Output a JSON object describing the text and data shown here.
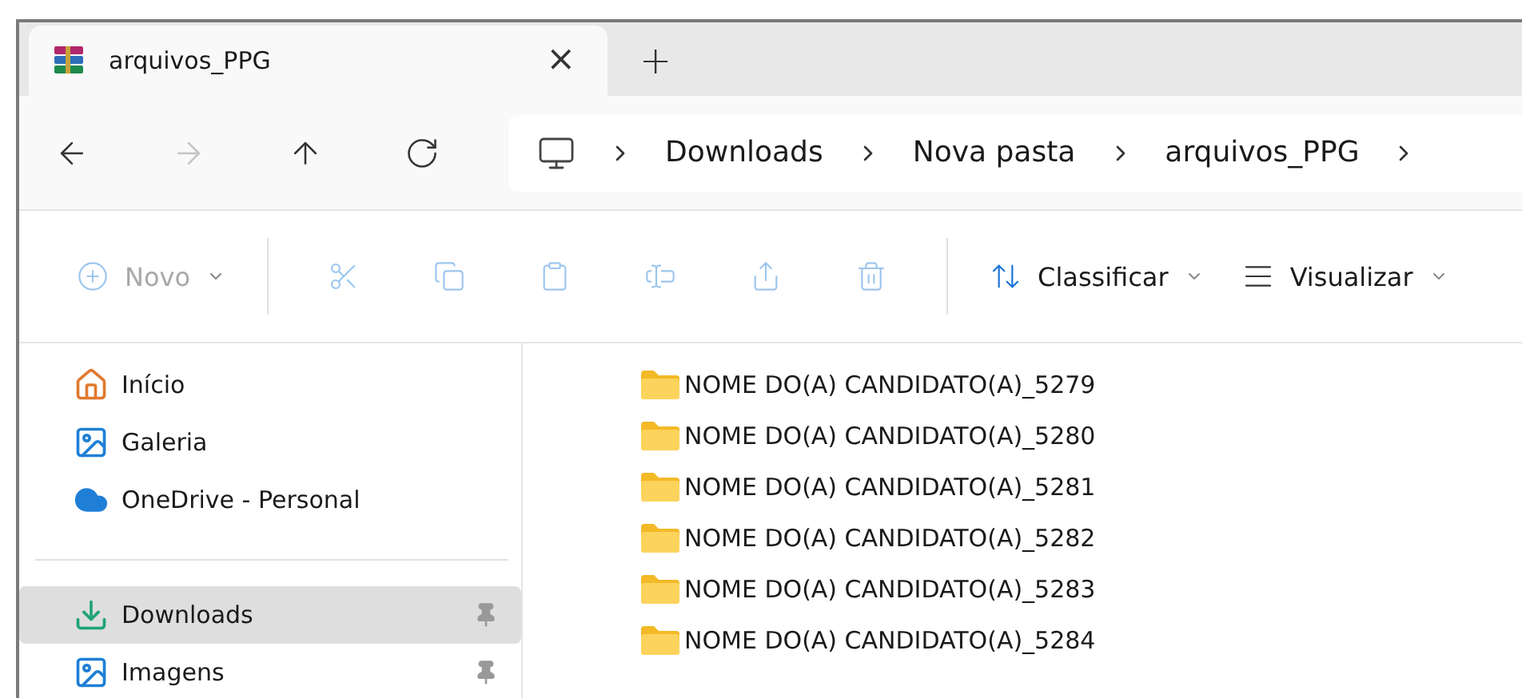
{
  "tabs": [
    {
      "label": "arquivos_PPG",
      "selected": true,
      "close": "×"
    }
  ],
  "new_tab": "+",
  "nav": [
    {
      "disabled": false
    },
    {
      "disabled": true
    },
    {
      "disabled": false
    },
    {
      "disabled": false
    }
  ],
  "breadcrumb": [
    "Downloads",
    "Nova pasta",
    "arquivos_PPG"
  ],
  "toolbar": [
    {
      "kind": "menu",
      "label": "Novo",
      "disabled": true
    },
    {
      "kind": "separator"
    },
    {
      "kind": "icon",
      "disabled": true
    },
    {
      "kind": "icon",
      "disabled": true
    },
    {
      "kind": "icon",
      "disabled": true
    },
    {
      "kind": "icon",
      "disabled": true
    },
    {
      "kind": "icon",
      "disabled": true
    },
    {
      "kind": "icon",
      "disabled": true
    },
    {
      "kind": "separator"
    },
    {
      "kind": "menu",
      "label": "Classificar",
      "disabled": false
    },
    {
      "kind": "menu",
      "label": "Visualizar",
      "disabled": false
    }
  ],
  "sidebar": {
    "groups": [
      [
        {
          "label": "Início",
          "selected": false,
          "pinned": false
        },
        {
          "label": "Galeria",
          "selected": false,
          "pinned": false
        },
        {
          "label": "OneDrive - Personal",
          "selected": false,
          "pinned": false
        }
      ],
      [
        {
          "label": "Downloads",
          "selected": true,
          "pinned": true
        },
        {
          "label": "Imagens",
          "selected": false,
          "pinned": true
        }
      ]
    ]
  },
  "files": [
    {
      "name": "NOME DO(A) CANDIDATO(A)_5279"
    },
    {
      "name": "NOME DO(A) CANDIDATO(A)_5280"
    },
    {
      "name": "NOME DO(A) CANDIDATO(A)_5281"
    },
    {
      "name": "NOME DO(A) CANDIDATO(A)_5282"
    },
    {
      "name": "NOME DO(A) CANDIDATO(A)_5283"
    },
    {
      "name": "NOME DO(A) CANDIDATO(A)_5284"
    }
  ]
}
